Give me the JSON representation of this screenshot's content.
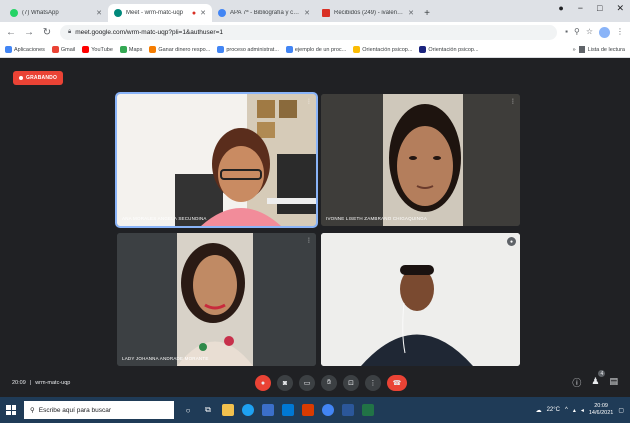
{
  "browser": {
    "tabs": [
      {
        "title": "(7) WhatsApp",
        "favicon_color": "#25d366",
        "active": false,
        "recording": false
      },
      {
        "title": "Meet - wrm-matc-uqp",
        "favicon_color": "#00897b",
        "active": true,
        "recording": true
      },
      {
        "title": "APA 7ª - Bibliografía y citas - Gu",
        "favicon_color": "#4285f4",
        "active": false,
        "recording": false
      },
      {
        "title": "Recibidos (249) - ivalencia@u",
        "favicon_color": "#d93025",
        "active": false,
        "recording": false
      }
    ],
    "address": "meet.google.com/wrm-matc-uqp?pli=1&authuser=1",
    "bookmarks": [
      {
        "label": "Aplicaciones",
        "color": "#4285f4"
      },
      {
        "label": "Gmail",
        "color": "#ea4335"
      },
      {
        "label": "YouTube",
        "color": "#ff0000"
      },
      {
        "label": "Maps",
        "color": "#34a853"
      },
      {
        "label": "Ganar dinero respo...",
        "color": "#f57c00"
      },
      {
        "label": "proceso administrat...",
        "color": "#4285f4"
      },
      {
        "label": "ejemplo de un proc...",
        "color": "#4285f4"
      },
      {
        "label": "Orientación psicop...",
        "color": "#fbbc04"
      },
      {
        "label": "Orientación psicop...",
        "color": "#1a237e"
      }
    ],
    "reading_list": "Lista de lectura"
  },
  "meet": {
    "recording_label": "GRABANDO",
    "participants": [
      {
        "name": "ANA MORALES ANGELA SECUNDINA",
        "speaking": true
      },
      {
        "name": "IVONNE LISETH ZAMBRANO CHIGAQUINGA",
        "speaking": false
      },
      {
        "name": "LADY JOHANNA ANDRADE MORANTE",
        "speaking": false
      },
      {
        "name": "",
        "speaking": false
      }
    ],
    "time": "20:09",
    "code": "wrm-matc-uqp",
    "people_count": "4"
  },
  "taskbar": {
    "search_placeholder": "Escribe aquí para buscar",
    "temperature": "22°C",
    "time": "20:09",
    "date": "14/6/2021"
  }
}
